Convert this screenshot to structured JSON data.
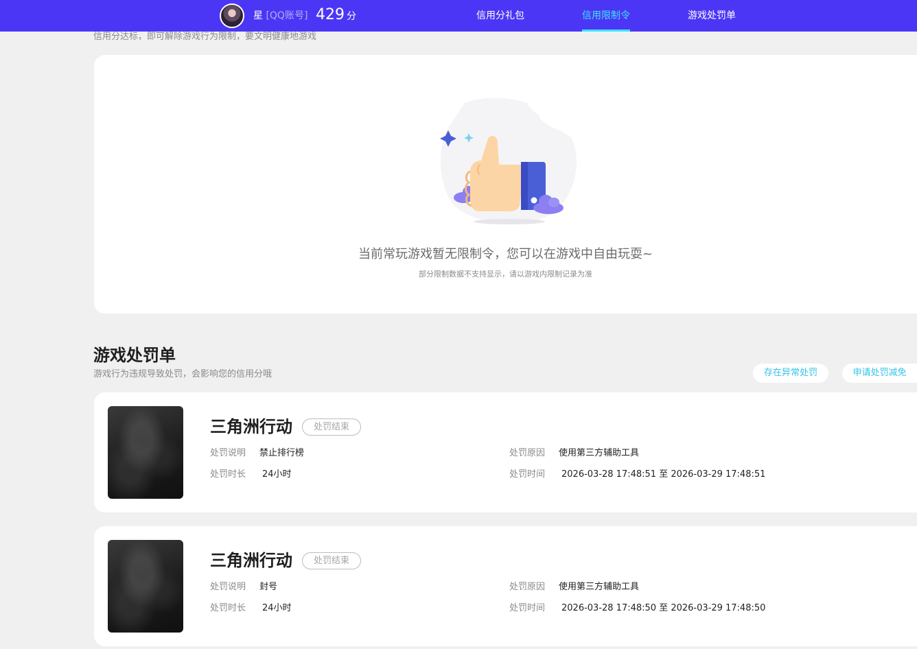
{
  "header": {
    "user_name": "星",
    "account_type": "[QQ账号]",
    "score": "429",
    "score_unit": "分",
    "tabs": [
      {
        "label": "信用分礼包",
        "active": false
      },
      {
        "label": "信用限制令",
        "active": true
      },
      {
        "label": "游戏处罚单",
        "active": false
      }
    ],
    "colors": {
      "bar": "#4c36f5",
      "active_tab": "#3ee4f8"
    }
  },
  "restriction": {
    "subtitle": "信用分达标，即可解除游戏行为限制，要文明健康地游戏",
    "empty_message": "当前常玩游戏暂无限制令，您可以在游戏中自由玩耍~",
    "empty_note": "部分限制数据不支持显示，请以游戏内限制记录为准",
    "illustration_icon": "thumbs-up-icon"
  },
  "penalties": {
    "title": "游戏处罚单",
    "subtitle": "游戏行为违规导致处罚，会影响您的信用分哦",
    "abnormal_button": "存在异常处罚",
    "reduce_button": "申请处罚减免",
    "labels": {
      "description": "处罚说明",
      "duration": "处罚时长",
      "reason": "处罚原因",
      "time": "处罚时间"
    },
    "items": [
      {
        "game": "三角洲行动",
        "status": "处罚结束",
        "description": "禁止排行榜",
        "duration": "24小时",
        "reason": "使用第三方辅助工具",
        "time": "2026-03-28 17:48:51 至 2026-03-29 17:48:51"
      },
      {
        "game": "三角洲行动",
        "status": "处罚结束",
        "description": "封号",
        "duration": "24小时",
        "reason": "使用第三方辅助工具",
        "time": "2026-03-28 17:48:50 至 2026-03-29 17:48:50"
      }
    ]
  }
}
